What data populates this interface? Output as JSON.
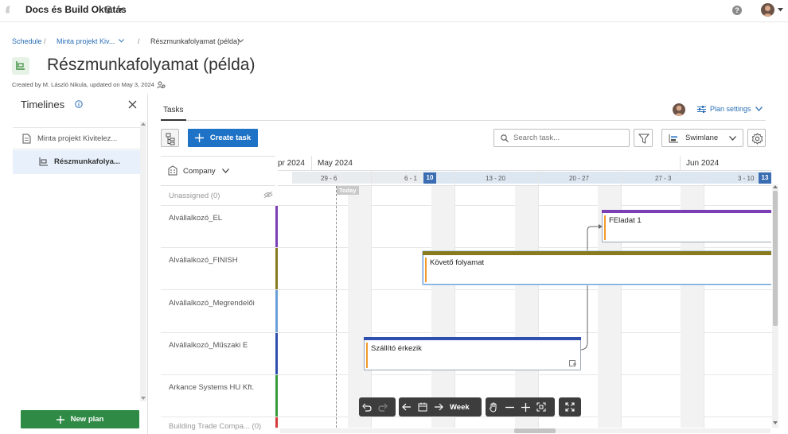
{
  "app": {
    "title": "Docs és Build Oktatás"
  },
  "breadcrumb": {
    "root": "Schedule",
    "project": "Minta projekt Kiv...",
    "current": "Részmunkafolyamat (példa)",
    "sep": "/"
  },
  "page": {
    "title": "Részmunkafolyamat (példa)",
    "subtitle": "Created by M. László Nikula, updated on May 3, 2024"
  },
  "sidebar": {
    "title": "Timelines",
    "items": [
      {
        "label": "Minta projekt Kivitelez..."
      },
      {
        "label": "Részmunkafolya..."
      }
    ],
    "new_plan": "New plan"
  },
  "tabs": {
    "tasks": "Tasks"
  },
  "plan_settings": "Plan settings",
  "toolbar": {
    "create_task": "Create task",
    "search_placeholder": "Search task...",
    "swimlane": "Swimlane",
    "group_by": "Company"
  },
  "timeline": {
    "months": [
      "pr 2024",
      "May 2024",
      "Jun 2024"
    ],
    "weeks": [
      "29 - 6",
      "6 - 1",
      "13 - 20",
      "20 - 27",
      "27 - 3",
      "3 - 10"
    ],
    "day_badges": [
      "10",
      "13"
    ],
    "today": "Today"
  },
  "lanes": [
    {
      "label": "Unassigned (0)",
      "color": ""
    },
    {
      "label": "Alvállalkozó_EL",
      "color": "#7b3fb5"
    },
    {
      "label": "Alvállalkozó_FINISH",
      "color": "#8a7a1e"
    },
    {
      "label": "Alvállalkozó_Megrendelői",
      "color": "#6a9fd8"
    },
    {
      "label": "Alvállalkozó_Műszaki E",
      "color": "#2f4fae"
    },
    {
      "label": "Arkance Systems HU Kft.",
      "color": "#3a9a3e"
    },
    {
      "label": "Building Trade Compa... (0)",
      "color": "#d63a3a"
    }
  ],
  "tasks": [
    {
      "name": "FEladat 1",
      "color": "#7b3fb5"
    },
    {
      "name": "Követő folyamat",
      "color": "#8a7a1e"
    },
    {
      "name": "Szállító érkezik",
      "color": "#2f4fae"
    }
  ],
  "view": {
    "scale": "Week"
  },
  "icons": [
    "globe-icon",
    "help-icon",
    "info-icon",
    "close-icon",
    "plus-icon",
    "search-icon",
    "filter-icon",
    "swimlane-icon",
    "gear-icon",
    "undo-icon",
    "redo-icon",
    "arrow-left-icon",
    "calendar-icon",
    "arrow-right-icon",
    "hand-icon",
    "zoom-out-icon",
    "zoom-in-icon",
    "fit-icon",
    "fullscreen-icon"
  ]
}
